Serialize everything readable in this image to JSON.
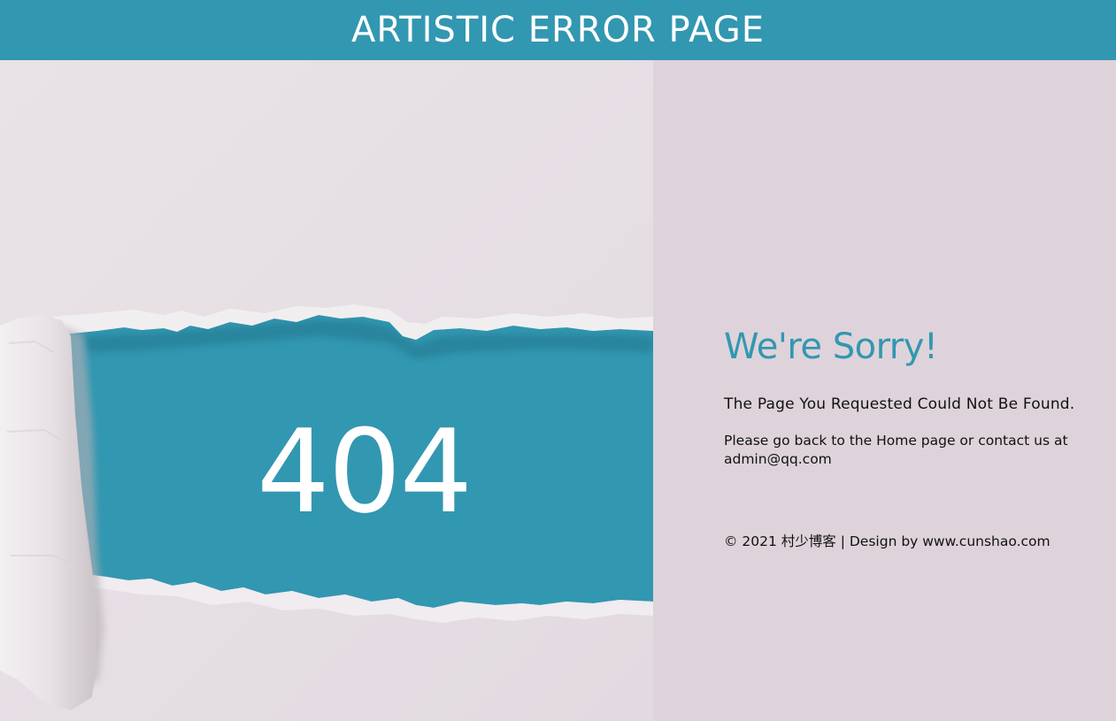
{
  "header": {
    "title": "ARTISTIC ERROR PAGE"
  },
  "hero": {
    "code": "404"
  },
  "main": {
    "heading": "We're Sorry!",
    "subheading": "The Page You Requested Could Not Be Found.",
    "message": "Please go back to the Home page or contact us at admin@qq.com"
  },
  "footer": {
    "copyright": "© 2021 村少博客 | Design by www.cunshao.com"
  },
  "colors": {
    "accent": "#3297b1",
    "background": "#ded3da",
    "paper": "#e6e0e4"
  }
}
